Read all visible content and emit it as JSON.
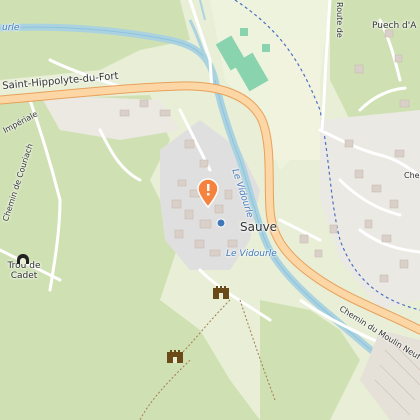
{
  "map": {
    "labels": {
      "road_hippolyte": "Saint-Hippolyte-du-Fort",
      "village": "Sauve",
      "poi_trou_de_cadet": "Trou de\nCadet",
      "river_vidourle_1": "Le Vidourle",
      "river_vidourle_2": "Le Vidourle",
      "river_top_left": "urle",
      "road_puech": "Puech d'A",
      "road_route_de": "Route de",
      "road_moulin": "Chemin du Moulin Neuf",
      "road_couriach": "Chemin de Couriach",
      "road_imperiale": "Impériale",
      "road_che": "Che"
    },
    "colors": {
      "land": "#e8efd6",
      "forest": "#cfe1b3",
      "dark_forest": "#add19e",
      "urban": "#e0dfdf",
      "building": "#d9d0c9",
      "water": "#aad3df",
      "river_stroke": "#8fc2e0",
      "major_road": "#fcd6a4",
      "major_road_casing": "#e8a15c",
      "minor_road": "#ffffff",
      "pitch": "#8ad3af",
      "marker": "#f5823e",
      "rail": "#4a6fc4"
    },
    "icons": {
      "location_marker": "map-pin-icon",
      "cave": "cave-icon",
      "castle_1": "castle-icon",
      "castle_2": "castle-icon",
      "viewpoint": "viewpoint-icon"
    }
  }
}
